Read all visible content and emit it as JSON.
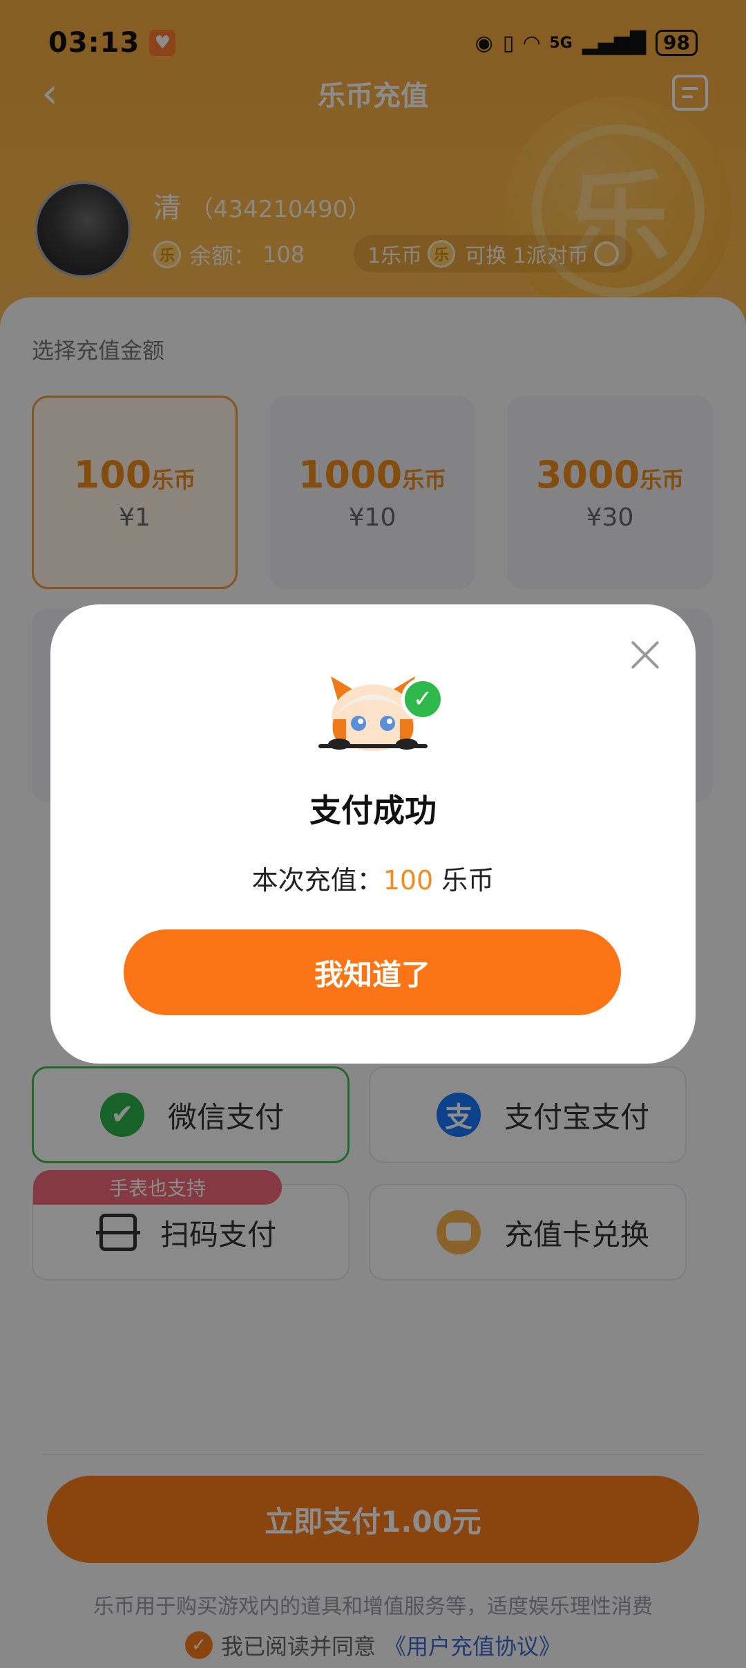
{
  "status_bar": {
    "time": "03:13",
    "network": "5G",
    "battery": "98"
  },
  "nav": {
    "title": "乐币充值"
  },
  "coin_deco_char": "乐",
  "user": {
    "name": "清",
    "uid": "（434210490）",
    "balance_label": "余额：",
    "balance_value": "108",
    "coin_glyph": "乐"
  },
  "rate": {
    "left": "1乐币",
    "mid": "可换 1派对币"
  },
  "recharge": {
    "section_label": "选择充值金额",
    "unit": "乐币",
    "options": [
      {
        "coins": "100",
        "price": "¥1",
        "selected": true
      },
      {
        "coins": "1000",
        "price": "¥10",
        "selected": false
      },
      {
        "coins": "3000",
        "price": "¥30",
        "selected": false
      }
    ]
  },
  "payment_methods": {
    "wechat": "微信支付",
    "alipay": "支付宝支付",
    "alipay_glyph": "支",
    "scan": "扫码支付",
    "card": "充值卡兑换",
    "watch_badge": "手表也支持"
  },
  "pay_button": "立即支付1.00元",
  "disclaimer": "乐币用于购买游戏内的道具和增值服务等，适度娱乐理性消费",
  "agreement": {
    "prefix": "我已阅读并同意",
    "link": "《用户充值协议》"
  },
  "dialog": {
    "title": "支付成功",
    "sub_prefix": "本次充值：",
    "sub_amount": "100",
    "sub_unit": " 乐币",
    "confirm": "我知道了"
  },
  "colors": {
    "accent": "#fb7415",
    "header": "#f5a93e",
    "success": "#2fb94a",
    "wechat": "#2bb34a",
    "alipay": "#1678ff",
    "link": "#3b6bd6"
  }
}
